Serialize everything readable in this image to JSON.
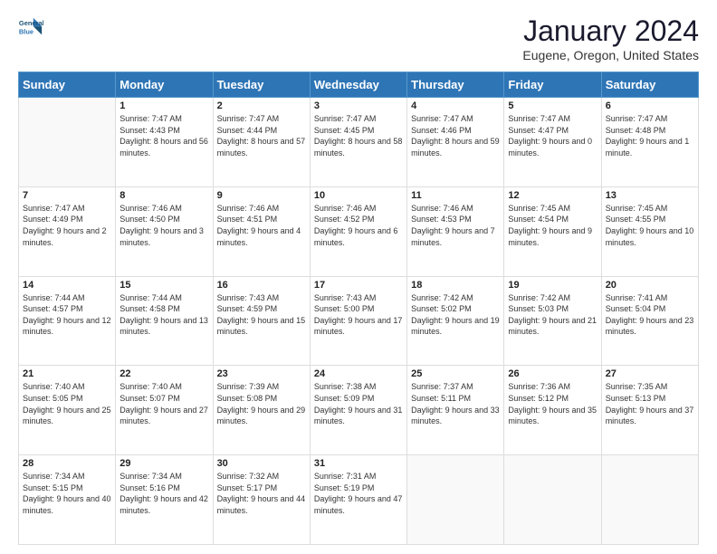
{
  "logo": {
    "line1": "General",
    "line2": "Blue"
  },
  "header": {
    "title": "January 2024",
    "subtitle": "Eugene, Oregon, United States"
  },
  "weekdays": [
    "Sunday",
    "Monday",
    "Tuesday",
    "Wednesday",
    "Thursday",
    "Friday",
    "Saturday"
  ],
  "weeks": [
    [
      {
        "day": "",
        "sunrise": "",
        "sunset": "",
        "daylight": ""
      },
      {
        "day": "1",
        "sunrise": "Sunrise: 7:47 AM",
        "sunset": "Sunset: 4:43 PM",
        "daylight": "Daylight: 8 hours and 56 minutes."
      },
      {
        "day": "2",
        "sunrise": "Sunrise: 7:47 AM",
        "sunset": "Sunset: 4:44 PM",
        "daylight": "Daylight: 8 hours and 57 minutes."
      },
      {
        "day": "3",
        "sunrise": "Sunrise: 7:47 AM",
        "sunset": "Sunset: 4:45 PM",
        "daylight": "Daylight: 8 hours and 58 minutes."
      },
      {
        "day": "4",
        "sunrise": "Sunrise: 7:47 AM",
        "sunset": "Sunset: 4:46 PM",
        "daylight": "Daylight: 8 hours and 59 minutes."
      },
      {
        "day": "5",
        "sunrise": "Sunrise: 7:47 AM",
        "sunset": "Sunset: 4:47 PM",
        "daylight": "Daylight: 9 hours and 0 minutes."
      },
      {
        "day": "6",
        "sunrise": "Sunrise: 7:47 AM",
        "sunset": "Sunset: 4:48 PM",
        "daylight": "Daylight: 9 hours and 1 minute."
      }
    ],
    [
      {
        "day": "7",
        "sunrise": "Sunrise: 7:47 AM",
        "sunset": "Sunset: 4:49 PM",
        "daylight": "Daylight: 9 hours and 2 minutes."
      },
      {
        "day": "8",
        "sunrise": "Sunrise: 7:46 AM",
        "sunset": "Sunset: 4:50 PM",
        "daylight": "Daylight: 9 hours and 3 minutes."
      },
      {
        "day": "9",
        "sunrise": "Sunrise: 7:46 AM",
        "sunset": "Sunset: 4:51 PM",
        "daylight": "Daylight: 9 hours and 4 minutes."
      },
      {
        "day": "10",
        "sunrise": "Sunrise: 7:46 AM",
        "sunset": "Sunset: 4:52 PM",
        "daylight": "Daylight: 9 hours and 6 minutes."
      },
      {
        "day": "11",
        "sunrise": "Sunrise: 7:46 AM",
        "sunset": "Sunset: 4:53 PM",
        "daylight": "Daylight: 9 hours and 7 minutes."
      },
      {
        "day": "12",
        "sunrise": "Sunrise: 7:45 AM",
        "sunset": "Sunset: 4:54 PM",
        "daylight": "Daylight: 9 hours and 9 minutes."
      },
      {
        "day": "13",
        "sunrise": "Sunrise: 7:45 AM",
        "sunset": "Sunset: 4:55 PM",
        "daylight": "Daylight: 9 hours and 10 minutes."
      }
    ],
    [
      {
        "day": "14",
        "sunrise": "Sunrise: 7:44 AM",
        "sunset": "Sunset: 4:57 PM",
        "daylight": "Daylight: 9 hours and 12 minutes."
      },
      {
        "day": "15",
        "sunrise": "Sunrise: 7:44 AM",
        "sunset": "Sunset: 4:58 PM",
        "daylight": "Daylight: 9 hours and 13 minutes."
      },
      {
        "day": "16",
        "sunrise": "Sunrise: 7:43 AM",
        "sunset": "Sunset: 4:59 PM",
        "daylight": "Daylight: 9 hours and 15 minutes."
      },
      {
        "day": "17",
        "sunrise": "Sunrise: 7:43 AM",
        "sunset": "Sunset: 5:00 PM",
        "daylight": "Daylight: 9 hours and 17 minutes."
      },
      {
        "day": "18",
        "sunrise": "Sunrise: 7:42 AM",
        "sunset": "Sunset: 5:02 PM",
        "daylight": "Daylight: 9 hours and 19 minutes."
      },
      {
        "day": "19",
        "sunrise": "Sunrise: 7:42 AM",
        "sunset": "Sunset: 5:03 PM",
        "daylight": "Daylight: 9 hours and 21 minutes."
      },
      {
        "day": "20",
        "sunrise": "Sunrise: 7:41 AM",
        "sunset": "Sunset: 5:04 PM",
        "daylight": "Daylight: 9 hours and 23 minutes."
      }
    ],
    [
      {
        "day": "21",
        "sunrise": "Sunrise: 7:40 AM",
        "sunset": "Sunset: 5:05 PM",
        "daylight": "Daylight: 9 hours and 25 minutes."
      },
      {
        "day": "22",
        "sunrise": "Sunrise: 7:40 AM",
        "sunset": "Sunset: 5:07 PM",
        "daylight": "Daylight: 9 hours and 27 minutes."
      },
      {
        "day": "23",
        "sunrise": "Sunrise: 7:39 AM",
        "sunset": "Sunset: 5:08 PM",
        "daylight": "Daylight: 9 hours and 29 minutes."
      },
      {
        "day": "24",
        "sunrise": "Sunrise: 7:38 AM",
        "sunset": "Sunset: 5:09 PM",
        "daylight": "Daylight: 9 hours and 31 minutes."
      },
      {
        "day": "25",
        "sunrise": "Sunrise: 7:37 AM",
        "sunset": "Sunset: 5:11 PM",
        "daylight": "Daylight: 9 hours and 33 minutes."
      },
      {
        "day": "26",
        "sunrise": "Sunrise: 7:36 AM",
        "sunset": "Sunset: 5:12 PM",
        "daylight": "Daylight: 9 hours and 35 minutes."
      },
      {
        "day": "27",
        "sunrise": "Sunrise: 7:35 AM",
        "sunset": "Sunset: 5:13 PM",
        "daylight": "Daylight: 9 hours and 37 minutes."
      }
    ],
    [
      {
        "day": "28",
        "sunrise": "Sunrise: 7:34 AM",
        "sunset": "Sunset: 5:15 PM",
        "daylight": "Daylight: 9 hours and 40 minutes."
      },
      {
        "day": "29",
        "sunrise": "Sunrise: 7:34 AM",
        "sunset": "Sunset: 5:16 PM",
        "daylight": "Daylight: 9 hours and 42 minutes."
      },
      {
        "day": "30",
        "sunrise": "Sunrise: 7:32 AM",
        "sunset": "Sunset: 5:17 PM",
        "daylight": "Daylight: 9 hours and 44 minutes."
      },
      {
        "day": "31",
        "sunrise": "Sunrise: 7:31 AM",
        "sunset": "Sunset: 5:19 PM",
        "daylight": "Daylight: 9 hours and 47 minutes."
      },
      {
        "day": "",
        "sunrise": "",
        "sunset": "",
        "daylight": ""
      },
      {
        "day": "",
        "sunrise": "",
        "sunset": "",
        "daylight": ""
      },
      {
        "day": "",
        "sunrise": "",
        "sunset": "",
        "daylight": ""
      }
    ]
  ]
}
